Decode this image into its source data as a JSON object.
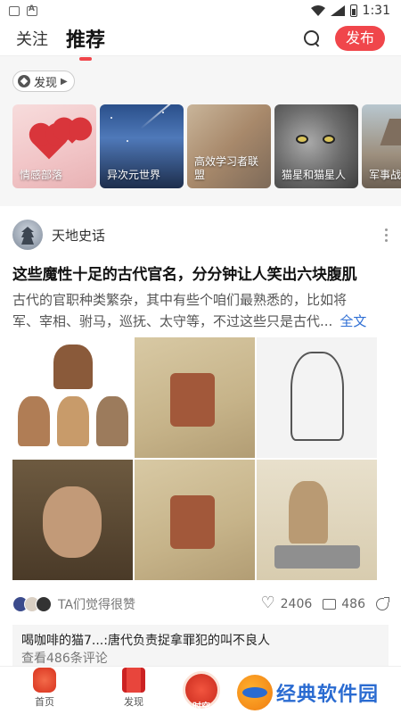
{
  "status_bar": {
    "time": "1:31"
  },
  "top_nav": {
    "tabs": [
      {
        "label": "关注"
      },
      {
        "label": "推荐"
      }
    ],
    "publish_label": "发布"
  },
  "discover": {
    "chip_label": "发现",
    "cards": [
      {
        "label": "情感部落"
      },
      {
        "label": "异次元世界"
      },
      {
        "label": "高效学习者联盟"
      },
      {
        "label": "猫星和猫星人"
      },
      {
        "label": "军事战与模型"
      }
    ]
  },
  "post": {
    "author": "天地史话",
    "title": "这些魔性十足的古代官名，分分钟让人笑出六块腹肌",
    "excerpt_line1": "古代的官职种类繁杂，其中有些个咱们最熟悉的，比如将",
    "excerpt_line2": "军、宰相、驸马，巡抚、太守等，不过这些只是古代...",
    "full_text_link": "全文",
    "liked_text": "TA们觉得很赞",
    "like_count": "2406",
    "comment_count": "486",
    "top_comment": {
      "user": "喝咖啡的猫7...:",
      "text": "唐代负责捉拿罪犯的叫不良人"
    },
    "view_comments_label": "查看486条评论"
  },
  "bottom_bar": {
    "items": [
      {
        "label": "首页"
      },
      {
        "label": "发现"
      }
    ],
    "center_label": "时空"
  },
  "watermark": {
    "text": "经典软件园"
  }
}
